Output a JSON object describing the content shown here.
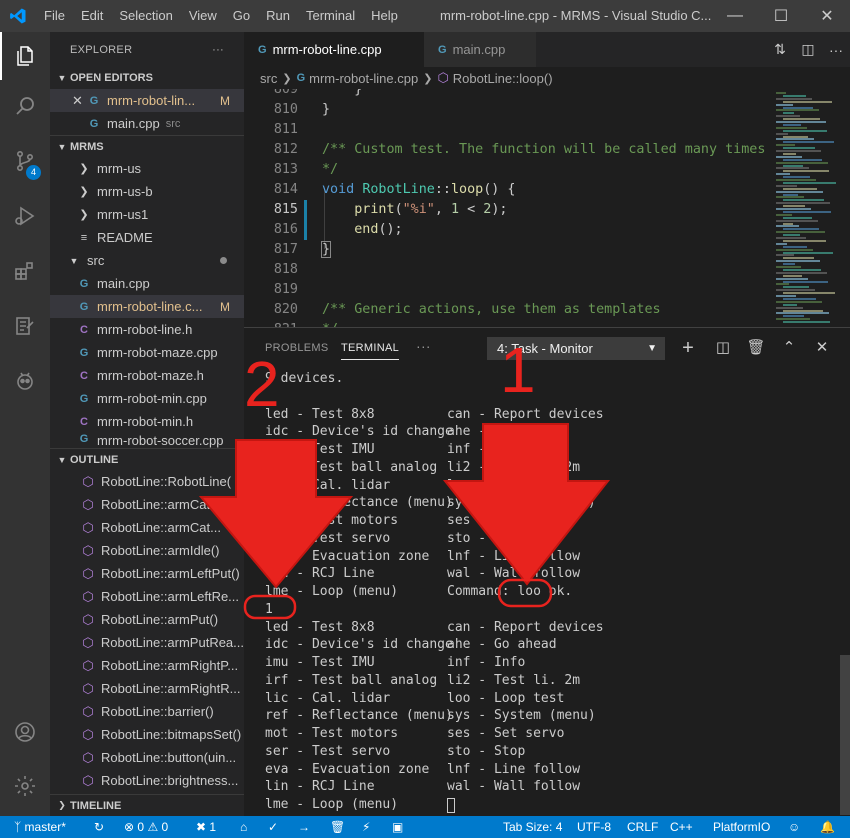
{
  "window": {
    "title": "mrm-robot-line.cpp - MRMS - Visual Studio C...",
    "menu": [
      "File",
      "Edit",
      "Selection",
      "View",
      "Go",
      "Run",
      "Terminal",
      "Help"
    ]
  },
  "activity_bar": {
    "items": [
      "explorer-icon",
      "search-icon",
      "source-control-icon",
      "run-debug-icon",
      "extensions-icon",
      "test-icon",
      "platformio-icon"
    ],
    "scm_badge": "4",
    "bottom": [
      "account-icon",
      "settings-gear-icon"
    ]
  },
  "sidebar": {
    "title": "EXPLORER",
    "more": "···",
    "open_editors": {
      "label": "OPEN EDITORS",
      "items": [
        {
          "name": "mrm-robot-lin...",
          "badge": "M",
          "type": "cpp"
        },
        {
          "name": "main.cpp",
          "hint": "src",
          "type": "cpp"
        }
      ]
    },
    "project": {
      "label": "MRMS",
      "folders": [
        "mrm-us",
        "mrm-us-b",
        "mrm-us1"
      ],
      "readme": "README",
      "src": "src",
      "files": [
        {
          "name": "main.cpp",
          "type": "cpp"
        },
        {
          "name": "mrm-robot-line.c...",
          "type": "cpp",
          "badge": "M"
        },
        {
          "name": "mrm-robot-line.h",
          "type": "h"
        },
        {
          "name": "mrm-robot-maze.cpp",
          "type": "cpp"
        },
        {
          "name": "mrm-robot-maze.h",
          "type": "h"
        },
        {
          "name": "mrm-robot-min.cpp",
          "type": "cpp"
        },
        {
          "name": "mrm-robot-min.h",
          "type": "h"
        },
        {
          "name": "mrm-robot-soccer.cpp",
          "type": "cpp"
        }
      ]
    },
    "outline": {
      "label": "OUTLINE",
      "items": [
        "RobotLine::RobotLine(",
        "RobotLine::armCatch()",
        "RobotLine::armCat...",
        "RobotLine::armIdle()",
        "RobotLine::armLeftPut()",
        "RobotLine::armLeftRe...",
        "RobotLine::armPut()",
        "RobotLine::armPutRea...",
        "RobotLine::armRightP...",
        "RobotLine::armRightR...",
        "RobotLine::barrier()",
        "RobotLine::bitmapsSet()",
        "RobotLine::button(uin...",
        "RobotLine::brightness..."
      ]
    },
    "timeline": "TIMELINE"
  },
  "tabs": [
    {
      "label": "mrm-robot-line.cpp",
      "active": true
    },
    {
      "label": "main.cpp",
      "active": false
    }
  ],
  "breadcrumb": [
    "src",
    "mrm-robot-line.cpp",
    "RobotLine::loop()"
  ],
  "editor": {
    "lines": [
      {
        "n": "809",
        "text": "    }"
      },
      {
        "n": "810",
        "text": "}"
      },
      {
        "n": "811",
        "text": ""
      },
      {
        "n": "812",
        "text": "/** Custom test. The function will be called many times"
      },
      {
        "n": "813",
        "text": "*/"
      },
      {
        "n": "814",
        "text": "void RobotLine::loop() {"
      },
      {
        "n": "815",
        "text": "    print(\"%i\", 1 < 2);"
      },
      {
        "n": "816",
        "text": "    end();"
      },
      {
        "n": "817",
        "text": "}"
      },
      {
        "n": "818",
        "text": ""
      },
      {
        "n": "819",
        "text": ""
      },
      {
        "n": "820",
        "text": "/** Generic actions, use them as templates"
      },
      {
        "n": "821",
        "text": "*/"
      }
    ]
  },
  "panel": {
    "tabs": [
      "PROBLEMS",
      "TERMINAL"
    ],
    "more": "···",
    "terminal_select": "4: Task - Monitor",
    "terminal_lines": [
      {
        "l": "9 devices.",
        "r": ""
      },
      {
        "l": "",
        "r": ""
      },
      {
        "l": "led - Test 8x8",
        "r": "can - Report devices"
      },
      {
        "l": "idc - Device's id change",
        "r": "ahe - Go ahead"
      },
      {
        "l": "imu - Test IMU",
        "r": "inf - Info"
      },
      {
        "l": "irf - Test ball analog",
        "r": "li2 - Test li. 2m"
      },
      {
        "l": "lic - Cal. lidar",
        "r": "loo - Loop test"
      },
      {
        "l": "ref - Reflectance (menu)",
        "r": "sys - System (menu)"
      },
      {
        "l": "mot - Test motors",
        "r": "ses - Set servo"
      },
      {
        "l": "ser - Test servo",
        "r": "sto - Stop"
      },
      {
        "l": "eva - Evacuation zone",
        "r": "lnf - Line follow"
      },
      {
        "l": "lin - RCJ Line",
        "r": "wal - Wall follow"
      },
      {
        "l": "lme - Loop (menu)",
        "r": "Command: loo ok."
      },
      {
        "l": "1",
        "r": ""
      },
      {
        "l": "led - Test 8x8",
        "r": "can - Report devices"
      },
      {
        "l": "idc - Device's id change",
        "r": "ahe - Go ahead"
      },
      {
        "l": "imu - Test IMU",
        "r": "inf - Info"
      },
      {
        "l": "irf - Test ball analog",
        "r": "li2 - Test li. 2m"
      },
      {
        "l": "lic - Cal. lidar",
        "r": "loo - Loop test"
      },
      {
        "l": "ref - Reflectance (menu)",
        "r": "sys - System (menu)"
      },
      {
        "l": "mot - Test motors",
        "r": "ses - Set servo"
      },
      {
        "l": "ser - Test servo",
        "r": "sto - Stop"
      },
      {
        "l": "eva - Evacuation zone",
        "r": "lnf - Line follow"
      },
      {
        "l": "lin - RCJ Line",
        "r": "wal - Wall follow"
      },
      {
        "l": "lme - Loop (menu)",
        "r": ""
      }
    ]
  },
  "statusbar": {
    "branch": "master*",
    "errors": "0",
    "warnings": "0",
    "tasks": "1",
    "tab_size": "Tab Size: 4",
    "encoding": "UTF-8",
    "eol": "CRLF",
    "language": "C++",
    "platform": "PlatformIO"
  },
  "annotations": {
    "label_1": "1",
    "label_2": "2",
    "color": "#e8231e"
  }
}
